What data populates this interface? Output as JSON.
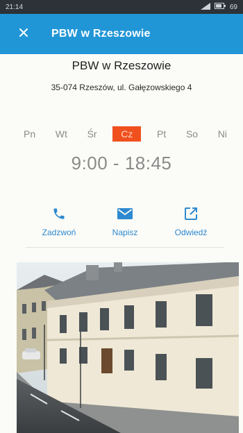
{
  "statusbar": {
    "time": "21:14",
    "battery": "69"
  },
  "toolbar": {
    "title": "PBW w Rzeszowie"
  },
  "header": {
    "name": "PBW w Rzeszowie",
    "address": "35-074 Rzeszów, ul. Gałęzowskiego 4"
  },
  "days": [
    {
      "label": "Pn",
      "active": false
    },
    {
      "label": "Wt",
      "active": false
    },
    {
      "label": "Śr",
      "active": false
    },
    {
      "label": "Cz",
      "active": true
    },
    {
      "label": "Pt",
      "active": false
    },
    {
      "label": "So",
      "active": false
    },
    {
      "label": "Ni",
      "active": false
    }
  ],
  "hours": "9:00 - 18:45",
  "actions": {
    "call": "Zadzwoń",
    "write": "Napisz",
    "visit": "Odwiedź"
  },
  "colors": {
    "accent": "#2196d6",
    "highlight": "#f0501e",
    "link": "#2d89d0"
  },
  "icons": {
    "close": "close-icon",
    "call": "phone-icon",
    "write": "mail-icon",
    "visit": "open-external-icon"
  }
}
